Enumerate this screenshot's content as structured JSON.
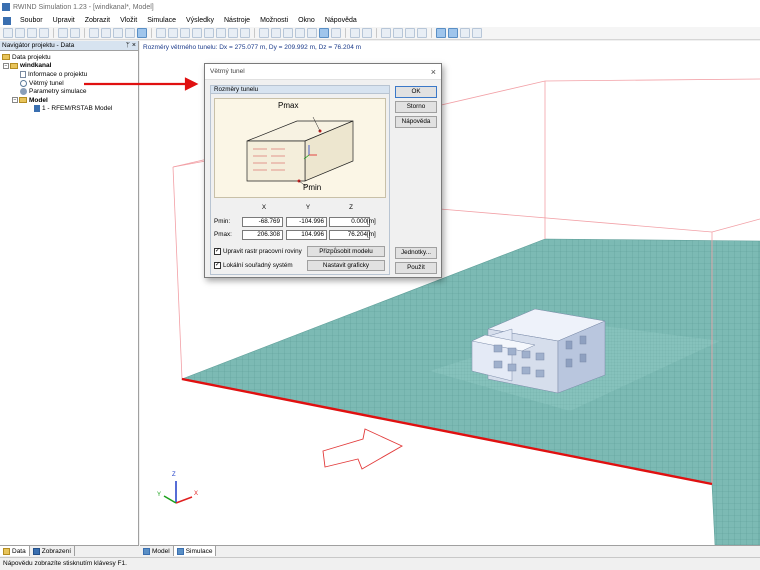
{
  "app": {
    "window_title": "RWIND Simulation 1.23 - [windkanal*, Model]"
  },
  "menu": [
    "Soubor",
    "Upravit",
    "Zobrazit",
    "Vložit",
    "Simulace",
    "Výsledky",
    "Nástroje",
    "Možnosti",
    "Okno",
    "Nápověda"
  ],
  "navigator": {
    "header": "Navigátor projektu - Data",
    "controls": [
      "ᛘ",
      "×"
    ],
    "tree": [
      {
        "label": "Data projektu",
        "level": 0,
        "icon": "folder-icon",
        "bold": false
      },
      {
        "label": "windkanal",
        "level": 1,
        "icon": "folder-icon",
        "bold": true
      },
      {
        "label": "Informace o projektu",
        "level": 2,
        "icon": "document-icon",
        "bold": false
      },
      {
        "label": "Větrný tunel",
        "level": 2,
        "icon": "wind-tunnel-icon",
        "bold": false
      },
      {
        "label": "Parametry simulace",
        "level": 2,
        "icon": "settings-icon",
        "bold": false
      },
      {
        "label": "Model",
        "level": 2,
        "icon": "folder-icon",
        "bold": true
      },
      {
        "label": "1 - RFEM/RSTAB Model",
        "level": 3,
        "icon": "model-icon",
        "bold": false
      }
    ],
    "tabs": [
      {
        "label": "Data",
        "active": true
      },
      {
        "label": "Zobrazení",
        "active": false
      }
    ]
  },
  "viewport": {
    "info": "Rozměry větrného tunelu: Dx = 275.077 m, Dy = 209.992 m, Dz = 76.204 m",
    "axes": {
      "x": "X",
      "y": "Y",
      "z": "Z"
    }
  },
  "view_tabs": [
    {
      "label": "Model",
      "active": false
    },
    {
      "label": "Simulace",
      "active": true
    }
  ],
  "status": "Nápovědu zobrazíte stisknutím klávesy F1.",
  "dialog": {
    "title": "Větrný tunel",
    "close": "×",
    "group_title": "Rozměry tunelu",
    "illustration": {
      "pmax": "Pmax",
      "pmin": "Pmin"
    },
    "columns": [
      "X",
      "Y",
      "Z"
    ],
    "rows": [
      {
        "label": "Pmin:",
        "values": [
          "-68.769",
          "-104.996",
          "0.000"
        ],
        "unit": "[m]"
      },
      {
        "label": "Pmax:",
        "values": [
          "206.308",
          "104.996",
          "76.204"
        ],
        "unit": "[m]"
      }
    ],
    "checkboxes": [
      {
        "label": "Upravit rastr pracovní roviny",
        "checked": true
      },
      {
        "label": "Lokální souřadný systém",
        "checked": true
      }
    ],
    "fit_button": "Přizpůsobit modelu",
    "graphic_button": "Nastavit graficky",
    "buttons": {
      "ok": "OK",
      "cancel": "Storno",
      "help": "Nápověda",
      "units": "Jednotky...",
      "apply": "Použít"
    }
  },
  "colors": {
    "grid": "#6fb3ad",
    "tunnel_edge": "#f2a0a6",
    "annotation_arrow": "#e01010",
    "building": "#dfe7f4"
  }
}
